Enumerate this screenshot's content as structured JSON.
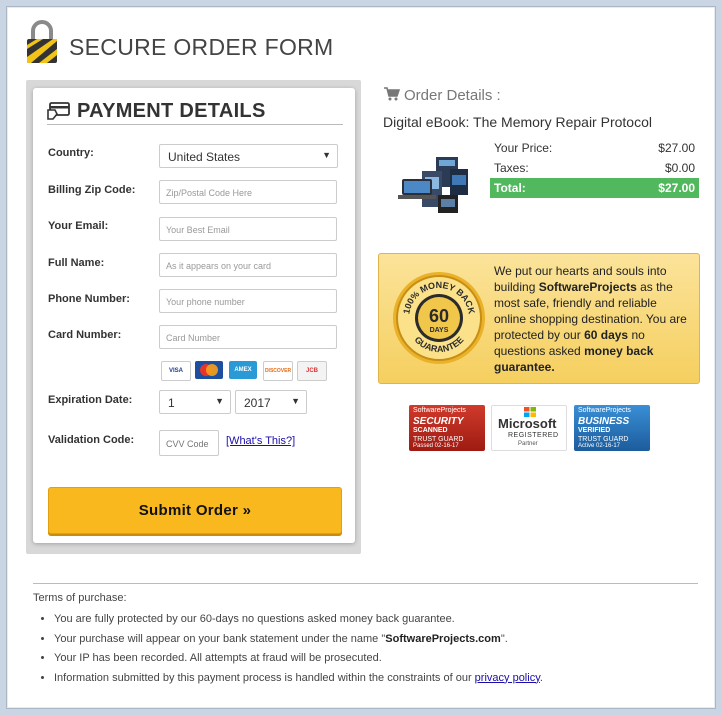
{
  "header": {
    "title": "SECURE ORDER FORM"
  },
  "payment": {
    "title": "PAYMENT DETAILS",
    "country": {
      "label": "Country:",
      "value": "United States"
    },
    "zip": {
      "label": "Billing Zip Code:",
      "placeholder": "Zip/Postal Code Here"
    },
    "email": {
      "label": "Your Email:",
      "placeholder": "Your Best Email"
    },
    "name": {
      "label": "Full Name:",
      "placeholder": "As it appears on your card"
    },
    "phone": {
      "label": "Phone Number:",
      "placeholder": "Your phone number"
    },
    "card": {
      "label": "Card Number:",
      "placeholder": "Card Number"
    },
    "card_logos": [
      "VISA",
      "MC",
      "AMEX",
      "DISCOVER",
      "JCB"
    ],
    "expiration": {
      "label": "Expiration Date:",
      "month": "1",
      "year": "2017"
    },
    "cvv": {
      "label": "Validation Code:",
      "placeholder": "CVV Code",
      "help_link": "[What's This?]"
    },
    "submit_label": "Submit Order »"
  },
  "order": {
    "heading": "Order Details :",
    "product": "Digital eBook: The Memory Repair Protocol",
    "price": {
      "label": "Your Price:",
      "value": "$27.00"
    },
    "taxes": {
      "label": "Taxes:",
      "value": "$0.00"
    },
    "total": {
      "label": "Total:",
      "value": "$27.00"
    }
  },
  "guarantee": {
    "seal_top": "100% MONEY BACK",
    "seal_days": "60",
    "seal_days_word": "DAYS",
    "seal_bottom": "GUARANTEE",
    "text_a": "We put our hearts and souls into building ",
    "brand": "SoftwareProjects",
    "text_b": " as the most safe, friendly and reliable online shopping destination. You are protected by our ",
    "days": "60 days",
    "text_c": " no questions asked ",
    "mbg": "money back guarantee."
  },
  "badges": {
    "security": {
      "top": "SoftwareProjects",
      "main": "SECURITY",
      "sub": "SCANNED",
      "trust": "TRUST GUARD",
      "date": "Passed 02-16-17"
    },
    "microsoft": {
      "logo": "Microsoft",
      "line1": "REGISTERED",
      "line2": "Partner"
    },
    "business": {
      "top": "SoftwareProjects",
      "main": "BUSINESS",
      "sub": "VERIFIED",
      "trust": "TRUST GUARD",
      "date": "Active 02-16-17"
    }
  },
  "terms": {
    "label": "Terms of purchase:",
    "item1": "You are fully protected by our 60-days no questions asked money back guarantee.",
    "item2_a": "Your purchase will appear on your bank statement under the name \"",
    "item2_b": "SoftwareProjects.com",
    "item2_c": "\".",
    "item3": "Your IP has been recorded. All attempts at fraud will be prosecuted.",
    "item4_a": "Information submitted by this payment process is handled within the constraints of our ",
    "item4_link": "privacy policy",
    "item4_c": "."
  },
  "colors": {
    "submit": "#f9b81e",
    "total_bg": "#52b85d",
    "guarantee_bg": "#f5cf5f",
    "link": "#1a0dab"
  }
}
